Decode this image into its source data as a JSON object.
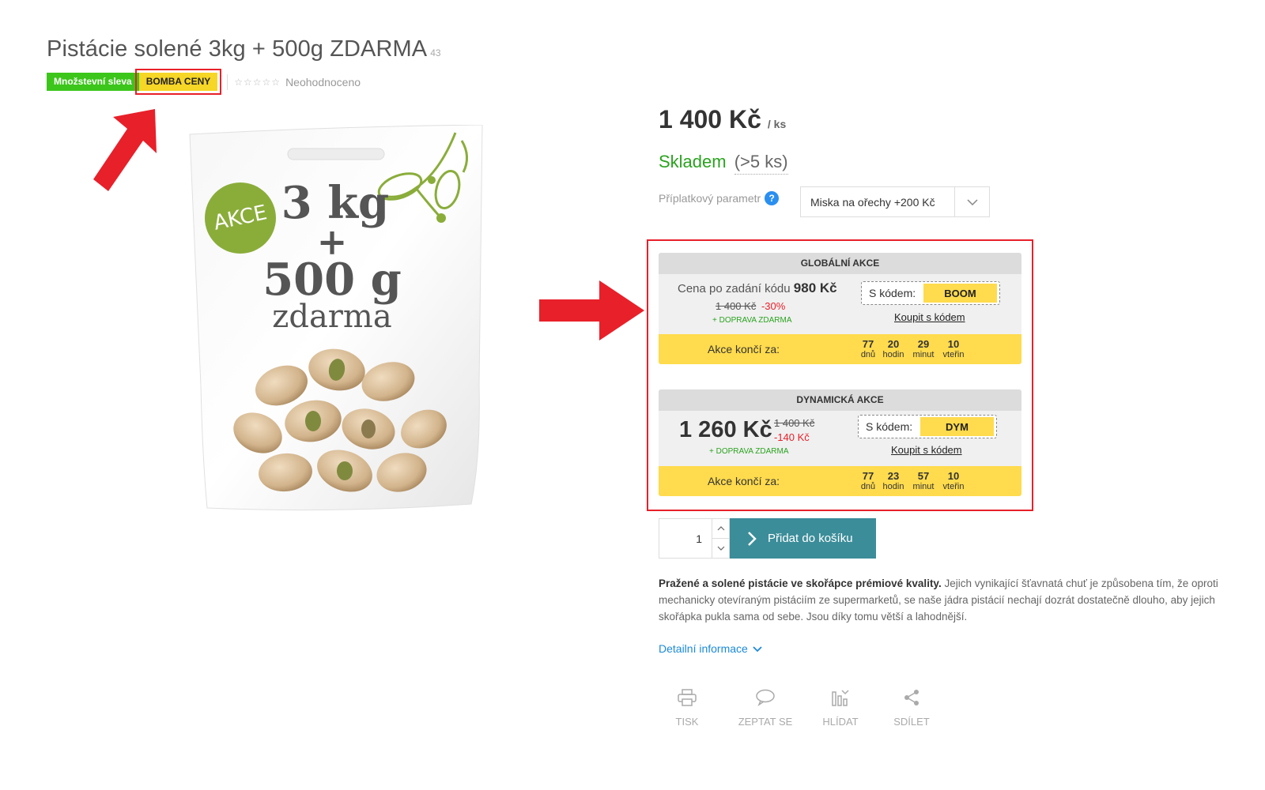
{
  "product": {
    "title": "Pistácie solené 3kg + 500g ZDARMA",
    "code": "43",
    "flags": [
      "Množstevní sleva",
      "BOMBA CENY"
    ],
    "rating_text": "Neohodnoceno",
    "image": {
      "badge": "AKCE",
      "line1": "3 kg",
      "line2": "+",
      "line3": "500 g",
      "line4": "zdarma"
    }
  },
  "pricing": {
    "price": "1 400 Kč",
    "unit": "/ ks",
    "stock_status": "Skladem",
    "stock_qty": "(>5 ks)"
  },
  "param": {
    "label": "Příplatkový parametr",
    "help": "?",
    "selected": "Miska na ořechy +200 Kč"
  },
  "global_promo": {
    "heading": "GLOBÁLNÍ AKCE",
    "price_prefix": "Cena po zadání kódu",
    "price": "980 Kč",
    "old_price": "1 400 Kč",
    "discount": "-30%",
    "shipping": "+ DOPRAVA ZDARMA",
    "code_label": "S kódem:",
    "code": "BOOM",
    "buy_link": "Koupit s kódem",
    "countdown_label": "Akce končí za:",
    "countdown": [
      {
        "num": "77",
        "unit": "dnů"
      },
      {
        "num": "20",
        "unit": "hodin"
      },
      {
        "num": "29",
        "unit": "minut"
      },
      {
        "num": "10",
        "unit": "vteřin"
      }
    ]
  },
  "dynamic_promo": {
    "heading": "DYNAMICKÁ AKCE",
    "price": "1 260 Kč",
    "old_price": "1 400 Kč",
    "discount": "-140 Kč",
    "shipping": "+ DOPRAVA ZDARMA",
    "code_label": "S kódem:",
    "code": "DYM",
    "buy_link": "Koupit s kódem",
    "countdown_label": "Akce končí za:",
    "countdown": [
      {
        "num": "77",
        "unit": "dnů"
      },
      {
        "num": "23",
        "unit": "hodin"
      },
      {
        "num": "57",
        "unit": "minut"
      },
      {
        "num": "10",
        "unit": "vteřin"
      }
    ]
  },
  "cart": {
    "quantity": "1",
    "button_label": "Přidat do košíku"
  },
  "description": {
    "bold": "Pražené a solené pistácie ve skořápce prémiové kvality.",
    "text": " Jejich vynikající šťavnatá chuť je způsobena tím, že oproti mechanicky otevíraným pistáciím ze supermarketů, se naše jádra pistácií nechají dozrát dostatečně dlouho, aby jejich skořápka pukla sama od sebe. Jsou díky tomu větší a lahodnější."
  },
  "detail_link": "Detailní informace",
  "actions": [
    {
      "label": "TISK",
      "icon": "print-icon"
    },
    {
      "label": "ZEPTAT SE",
      "icon": "chat-bubble-icon"
    },
    {
      "label": "HLÍDAT",
      "icon": "watchdog-chart-icon"
    },
    {
      "label": "SDÍLET",
      "icon": "share-icon"
    }
  ],
  "colors": {
    "accent_red": "#e8202a",
    "flag_green": "#3cc61b",
    "flag_yellow": "#f6d626",
    "countdown_yellow": "#ffdb4d",
    "cart_button": "#3b8d99",
    "stock_green": "#2aa31f",
    "link_blue": "#1b8ad8"
  }
}
